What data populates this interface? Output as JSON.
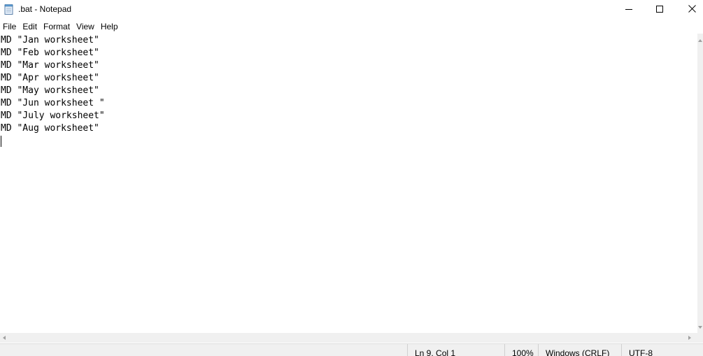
{
  "window": {
    "title": ".bat - Notepad",
    "app_icon": "notepad-icon",
    "controls": {
      "minimize_icon": "minimize-icon",
      "maximize_icon": "maximize-icon",
      "close_icon": "close-icon"
    }
  },
  "menubar": {
    "items": [
      {
        "label": "File"
      },
      {
        "label": "Edit"
      },
      {
        "label": "Format"
      },
      {
        "label": "View"
      },
      {
        "label": "Help"
      }
    ]
  },
  "editor": {
    "lines": [
      "MD \"Jan worksheet\"",
      "MD \"Feb worksheet\"",
      "MD \"Mar worksheet\"",
      "MD \"Apr worksheet\"",
      "MD \"May worksheet\"",
      "MD \"Jun worksheet \"",
      "MD \"July worksheet\"",
      "MD \"Aug worksheet\"",
      ""
    ]
  },
  "statusbar": {
    "position": "Ln 9, Col 1",
    "zoom": "100%",
    "line_ending": "Windows (CRLF)",
    "encoding": "UTF-8"
  },
  "colors": {
    "background": "#ffffff",
    "chrome": "#f0f0f0",
    "text": "#000000"
  }
}
